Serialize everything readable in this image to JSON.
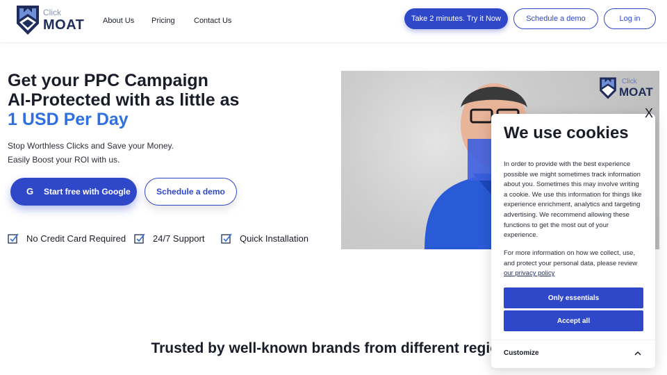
{
  "header": {
    "logo_click": "Click",
    "logo_moat": "MOAT",
    "nav": [
      "About Us",
      "Pricing",
      "Contact Us"
    ],
    "try_now": "Take 2 minutes. Try it Now",
    "schedule_demo": "Schedule a demo",
    "login": "Log in"
  },
  "hero": {
    "title_line1": "Get your PPC Campaign",
    "title_line2": "AI-Protected with as little as",
    "title_accent": "1 USD Per Day",
    "sub_line1": "Stop Worthless Clicks and Save your Money.",
    "sub_line2": "Easily Boost your ROI with us.",
    "google_cta": "Start free with Google",
    "demo_cta": "Schedule a demo",
    "features": [
      "No Credit Card Required",
      "24/7 Support",
      "Quick Installation"
    ]
  },
  "video": {
    "logo_click": "Click",
    "logo_moat": "MOAT"
  },
  "trusted": {
    "heading": "Trusted by well-known brands from different regions"
  },
  "cookie": {
    "close": "X",
    "title": "We use cookies",
    "body": "In order to provide with the best experience possible we might sometimes track information about you. Sometimes this may involve writing a cookie. We use this information for things like experience enrichment, analytics and targeting advertising. We recommend allowing these functions to get the most out of your experience.",
    "more_prefix": "For more information on how we collect, use, and protect your personal data, please review ",
    "privacy_link": "our privacy policy",
    "only_essentials": "Only essentials",
    "accept_all": "Accept all",
    "customize": "Customize"
  },
  "colors": {
    "brand_blue": "#2f47c9",
    "accent_blue": "#2f6fe0",
    "navy": "#1e2d5c"
  },
  "icons": [
    "click-moat-logo",
    "google-icon",
    "checkbox-check-icon",
    "chevron-up-icon"
  ]
}
